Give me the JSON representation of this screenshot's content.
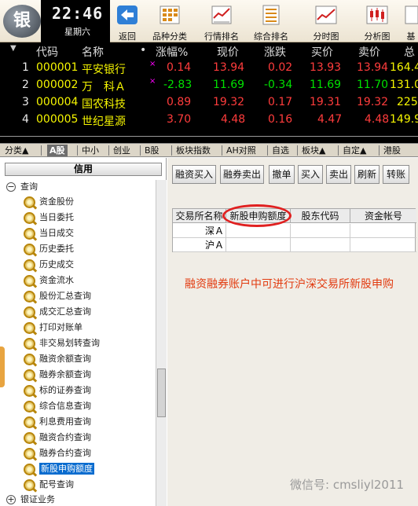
{
  "app": {
    "logo_text": "银",
    "clock": "22:46",
    "weekday": "星期六"
  },
  "toolbar": [
    {
      "label": "返回",
      "icon": "back-icon"
    },
    {
      "label": "品种分类",
      "icon": "category-icon"
    },
    {
      "label": "行情排名",
      "icon": "ranking-icon"
    },
    {
      "label": "综合排名",
      "icon": "composite-ranking-icon"
    },
    {
      "label": "分时图",
      "icon": "intraday-chart-icon"
    },
    {
      "label": "分析图",
      "icon": "candlestick-chart-icon"
    },
    {
      "label": "基",
      "icon": "fundamentals-icon"
    }
  ],
  "quotes": {
    "headers": [
      "代码",
      "名称",
      "•",
      "涨幅%",
      "现价",
      "涨跌",
      "买价",
      "卖价",
      "总"
    ],
    "rows": [
      {
        "idx": "1",
        "code": "000001",
        "name": "平安银行",
        "flag": "×",
        "pct": "0.14",
        "price": "13.94",
        "chg": "0.02",
        "bid": "13.93",
        "ask": "13.94",
        "vol": "164.4"
      },
      {
        "idx": "2",
        "code": "000002",
        "name": "万　科Ａ",
        "flag": "×",
        "pct": "-2.83",
        "price": "11.69",
        "chg": "-0.34",
        "bid": "11.69",
        "ask": "11.70",
        "vol": "131.0"
      },
      {
        "idx": "3",
        "code": "000004",
        "name": "国农科技",
        "flag": "",
        "pct": "0.89",
        "price": "19.32",
        "chg": "0.17",
        "bid": "19.31",
        "ask": "19.32",
        "vol": "225"
      },
      {
        "idx": "4",
        "code": "000005",
        "name": "世纪星源",
        "flag": "",
        "pct": "3.70",
        "price": "4.48",
        "chg": "0.16",
        "bid": "4.47",
        "ask": "4.48",
        "vol": "149.9"
      }
    ]
  },
  "tabs": [
    "分类▲",
    "A股",
    "中小",
    "创业",
    "B股",
    "板块指数",
    "AH对照",
    "自选",
    "板块▲",
    "自定▲",
    "港股"
  ],
  "left_panel": {
    "title": "信用",
    "root_label": "查询",
    "root_toggle": "−",
    "items": [
      "资金股份",
      "当日委托",
      "当日成交",
      "历史委托",
      "历史成交",
      "资金流水",
      "股份汇总查询",
      "成交汇总查询",
      "打印对账单",
      "非交易划转查询",
      "融资余额查询",
      "融券余额查询",
      "标的证券查询",
      "综合信息查询",
      "利息费用查询",
      "融资合约查询",
      "融券合约查询",
      "新股申购额度",
      "配号查询"
    ],
    "next_root_label": "银证业务",
    "next_root_toggle": "+"
  },
  "right_panel": {
    "buttons": [
      "融资买入",
      "融券卖出",
      "撤单",
      "买入",
      "卖出",
      "刷新",
      "转账"
    ],
    "table_headers": [
      "交易所名称",
      "新股申购额度",
      "股东代码",
      "资金帐号"
    ],
    "table_rows": [
      {
        "exchange": "深Ａ"
      },
      {
        "exchange": "沪Ａ"
      }
    ],
    "note": "融资融券账户中可进行沪深交易所新股申购",
    "watermark": "微信号: cmsliyl2011"
  }
}
